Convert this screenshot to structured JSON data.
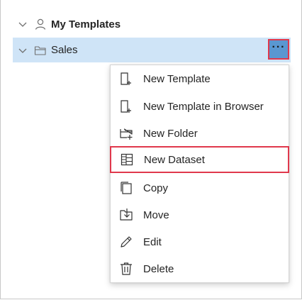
{
  "tree": {
    "root": {
      "label": "My Templates",
      "icon": "person-icon"
    },
    "folder": {
      "label": "Sales",
      "icon": "folder-icon",
      "more_label": "···"
    }
  },
  "menu": {
    "items": [
      {
        "label": "New Template",
        "icon": "new-template-icon"
      },
      {
        "label": "New Template in Browser",
        "icon": "new-template-browser-icon"
      },
      {
        "label": "New Folder",
        "icon": "new-folder-icon"
      },
      {
        "label": "New Dataset",
        "icon": "new-dataset-icon",
        "highlighted": true
      },
      {
        "label": "Copy",
        "icon": "copy-icon"
      },
      {
        "label": "Move",
        "icon": "move-icon"
      },
      {
        "label": "Edit",
        "icon": "edit-icon"
      },
      {
        "label": "Delete",
        "icon": "delete-icon"
      }
    ]
  },
  "colors": {
    "selection": "#cfe4f7",
    "more_button": "#5a97d1",
    "highlight_border": "#e0384c"
  }
}
